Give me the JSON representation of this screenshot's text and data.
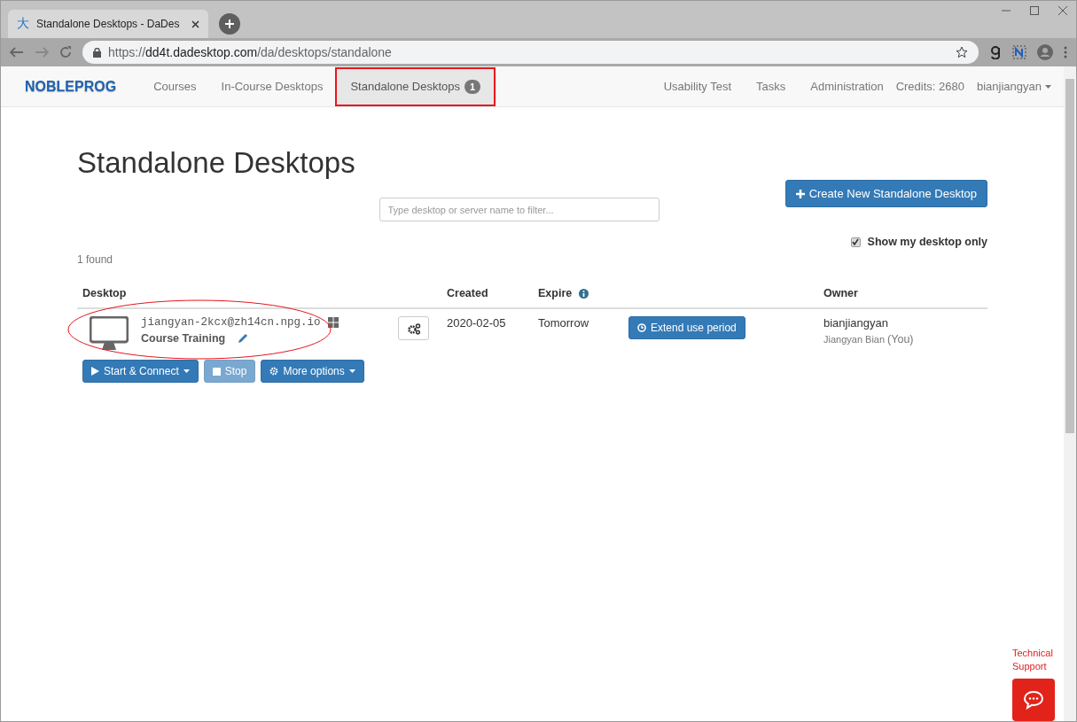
{
  "browser": {
    "favicon": "大",
    "tab_title": "Standalone Desktops - DaDes",
    "url": {
      "scheme": "https://",
      "host": "dd4t.dadesktop.com",
      "path": "/da/desktops/standalone"
    }
  },
  "nav": {
    "brand": "NOBLEPROG",
    "items": [
      {
        "label": "Courses",
        "selected": false
      },
      {
        "label": "In-Course Desktops",
        "selected": false
      },
      {
        "label": "Standalone Desktops",
        "selected": true,
        "badge": "1"
      }
    ],
    "right_items": [
      {
        "label": "Usability Test"
      },
      {
        "label": "Tasks"
      },
      {
        "label": "Administration"
      }
    ],
    "credits": "Credits: 2680",
    "user": "bianjiangyan"
  },
  "page": {
    "title": "Standalone Desktops",
    "create_button": "Create New Standalone Desktop",
    "filter": {
      "placeholder": "Type desktop or server name to filter..."
    },
    "show_mine": {
      "label": "Show my desktop only",
      "checked": true
    },
    "found": "1 found",
    "columns": [
      "Desktop",
      "Created",
      "Expire",
      "Owner"
    ],
    "rows": [
      {
        "host": "jiangyan-2kcx@zh14cn.npg.io",
        "name": "Course Training",
        "created": "2020-02-05",
        "expire": "Tomorrow",
        "extend_button": "Extend use period",
        "owner": "bianjiangyan",
        "owner_name": "Jiangyan Bian",
        "owner_you": "(You)",
        "highlighted": true,
        "actions": [
          {
            "kind": "start",
            "label": "Start & Connect",
            "disabled": false
          },
          {
            "kind": "stop",
            "label": "Stop",
            "disabled": true
          },
          {
            "kind": "more",
            "label": "More options",
            "disabled": false
          }
        ]
      }
    ]
  },
  "support": {
    "label": "Technical Support"
  }
}
